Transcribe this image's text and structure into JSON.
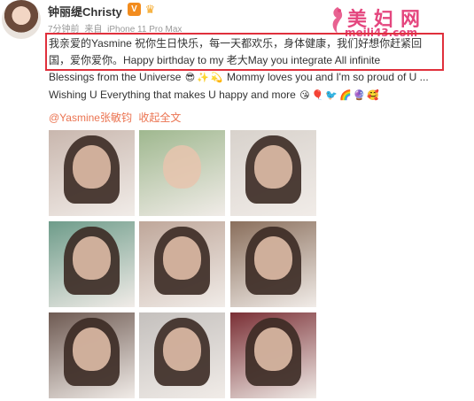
{
  "header": {
    "user_name": "钟丽缇Christy",
    "vip_badge": "V",
    "crown_badge": "♛",
    "time": "7分钟前",
    "source_prefix": "来自",
    "source_device": "iPhone 11 Pro Max"
  },
  "watermark": {
    "title": "美妇网",
    "url": "meili43.com"
  },
  "post": {
    "line1": "我亲爱的Yasmine 祝你生日快乐，每一天都欢乐，身体健康，我们好想你赶紧回",
    "line2": "国，爱你爱你。Happy birthday to my 老大May you integrate All infinite",
    "line3": "Blessings from the Universe",
    "line3_tail": "Mommy loves you and I'm so proud of U ...",
    "line4": "Wishing U Everything that makes U happy and more",
    "emojis_line3": [
      "😎",
      "✨",
      "💫"
    ],
    "emojis_line4": [
      "😘",
      "🎈",
      "🐦",
      "🌈",
      "🔮",
      "🥰"
    ]
  },
  "links": {
    "mention": "@Yasmine张敏钧",
    "expand": "收起全文"
  },
  "photos": [
    {
      "name": "photo-1",
      "bg": "#c9b7ae",
      "hair": true
    },
    {
      "name": "photo-2",
      "bg": "#9fb88f",
      "hair": false
    },
    {
      "name": "photo-3",
      "bg": "#d8d2cc",
      "hair": true
    },
    {
      "name": "photo-4",
      "bg": "#6e9c8a",
      "hair": true
    },
    {
      "name": "photo-5",
      "bg": "#bfa79a",
      "hair": true
    },
    {
      "name": "photo-6",
      "bg": "#8a6f5c",
      "hair": true
    },
    {
      "name": "photo-7",
      "bg": "#6e5a52",
      "hair": true
    },
    {
      "name": "photo-8",
      "bg": "#c4c0bd",
      "hair": true
    },
    {
      "name": "photo-9",
      "bg": "#7a2f35",
      "hair": true
    }
  ]
}
